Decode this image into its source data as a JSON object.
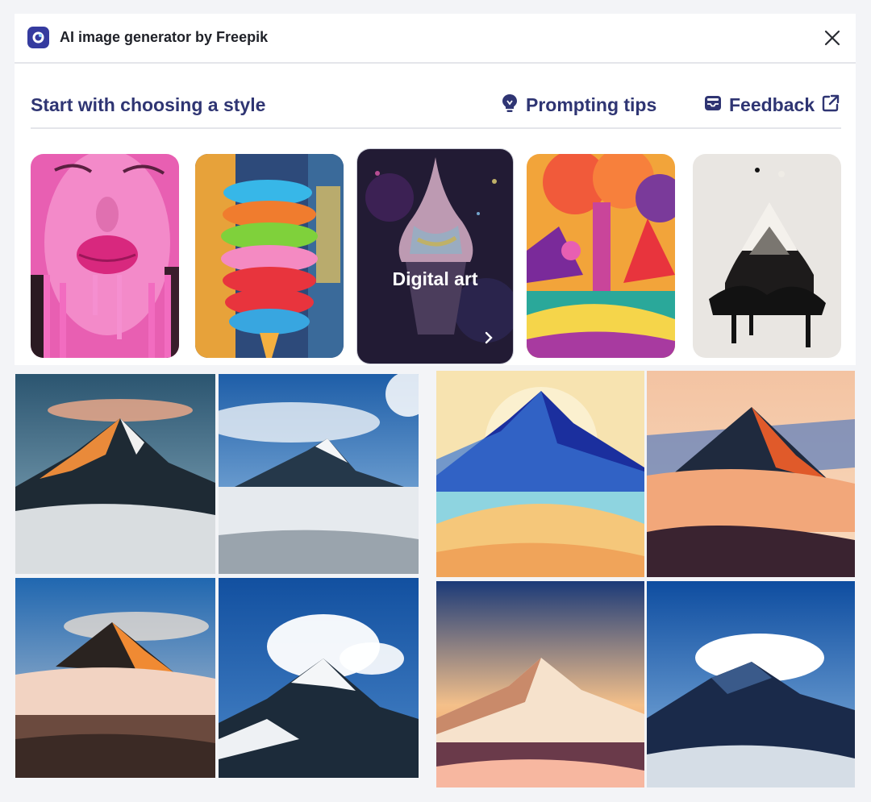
{
  "window": {
    "title": "AI image generator by Freepik",
    "app_icon": "freepik-ai-icon",
    "close_icon": "close-icon"
  },
  "header": {
    "heading": "Start with choosing a style",
    "tips_label": "Prompting tips",
    "tips_icon": "lightbulb-icon",
    "feedback_label": "Feedback",
    "feedback_icon": "inbox-icon",
    "external_icon": "external-link-icon"
  },
  "styles": [
    {
      "name": "pink-drip-portrait",
      "label": ""
    },
    {
      "name": "ice-cream-painting",
      "label": ""
    },
    {
      "name": "digital-art",
      "label": "Digital art",
      "selected": true,
      "icon": "chevron-right-icon"
    },
    {
      "name": "psychedelic-landscape",
      "label": ""
    },
    {
      "name": "ink-splash-mountain",
      "label": ""
    }
  ],
  "results": {
    "left_grid": [
      "mountain-photo-1",
      "mountain-photo-2",
      "mountain-photo-3",
      "mountain-photo-4"
    ],
    "right_grid": [
      "mountain-illustration-1",
      "mountain-illustration-2",
      "mountain-illustration-3",
      "mountain-illustration-4"
    ]
  },
  "colors": {
    "accent": "#2f3573",
    "background": "#f3f4f7"
  }
}
